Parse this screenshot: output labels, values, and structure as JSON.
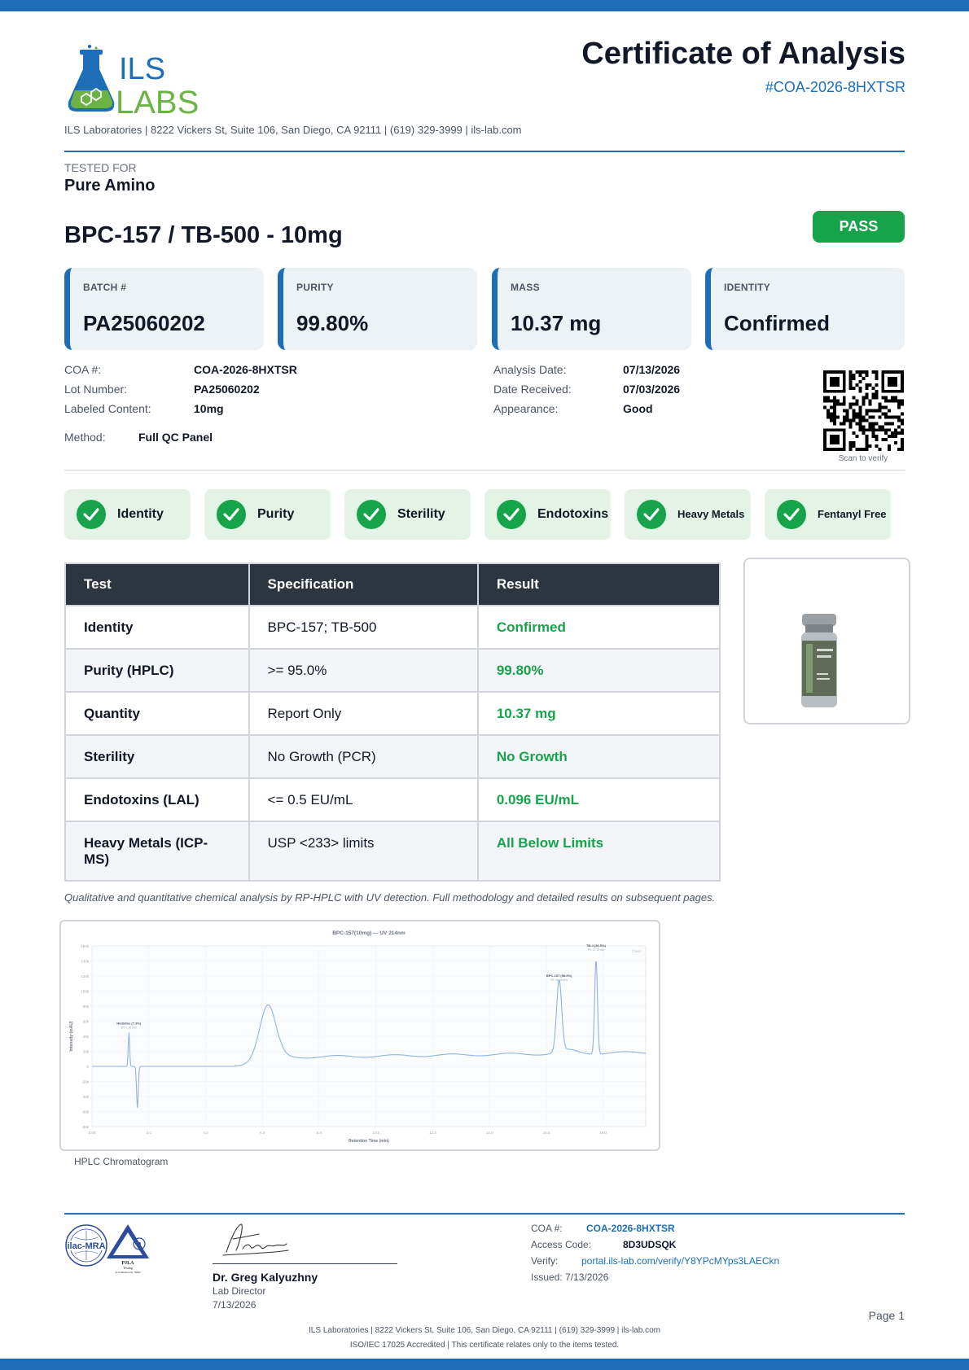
{
  "header": {
    "logo_text_top": "ILS",
    "logo_text_bottom": "LABS",
    "title": "Certificate of Analysis",
    "coa_id": "#COA-2026-8HXTSR",
    "lab_address": "ILS Laboratories  |  8222 Vickers St, Suite 106, San Diego, CA 92111  |  (619) 329-3999  |  ils-lab.com"
  },
  "tested_for": {
    "label": "TESTED FOR",
    "value": "Pure Amino"
  },
  "product": {
    "name": "BPC-157 / TB-500 - 10mg",
    "status": "PASS"
  },
  "summary_cards": [
    {
      "label": "BATCH #",
      "value": "PA25060202"
    },
    {
      "label": "PURITY",
      "value": "99.80%"
    },
    {
      "label": "MASS",
      "value": "10.37 mg"
    },
    {
      "label": "IDENTITY",
      "value": "Confirmed"
    }
  ],
  "meta_left": [
    {
      "label": "COA #:",
      "value": "COA-2026-8HXTSR"
    },
    {
      "label": "Lot Number:",
      "value": "PA25060202"
    },
    {
      "label": "Labeled Content:",
      "value": "10mg"
    }
  ],
  "method": {
    "label": "Method:",
    "value": "Full QC Panel"
  },
  "meta_right": [
    {
      "label": "Analysis Date:",
      "value": "07/13/2026"
    },
    {
      "label": "Date Received:",
      "value": "07/03/2026"
    },
    {
      "label": "Appearance:",
      "value": "Good"
    }
  ],
  "qr_caption": "Scan to verify",
  "badges": [
    "Identity",
    "Purity",
    "Sterility",
    "Endotoxins",
    "Heavy Metals",
    "Fentanyl Free"
  ],
  "results_table": {
    "headers": [
      "Test",
      "Specification",
      "Result"
    ],
    "rows": [
      {
        "test": "Identity",
        "spec": "BPC-157; TB-500",
        "result": "Confirmed"
      },
      {
        "test": "Purity (HPLC)",
        "spec": ">= 95.0%",
        "result": "99.80%"
      },
      {
        "test": "Quantity",
        "spec": "Report Only",
        "result": "10.37 mg"
      },
      {
        "test": "Sterility",
        "spec": "No Growth (PCR)",
        "result": "No Growth"
      },
      {
        "test": "Endotoxins (LAL)",
        "spec": "<= 0.5 EU/mL",
        "result": "0.096 EU/mL"
      },
      {
        "test": "Heavy Metals (ICP-MS)",
        "spec": "USP <233> limits",
        "result": "All Below Limits"
      }
    ]
  },
  "method_note": "Qualitative and quantitative chemical analysis by RP-HPLC with UV detection. Full methodology and detailed results on subsequent pages.",
  "chromatogram": {
    "title": "BPC-157(10mg) — UV 214nm",
    "xlabel": "Retention Time (min)",
    "ylabel": "Intensity (mAU)",
    "x_ticks": [
      "0.00",
      "2.0",
      "4.0",
      "6.0",
      "8.0",
      "10.0",
      "12.0",
      "14.0",
      "16.0",
      "18.0"
    ],
    "y_ticks": [
      "160k",
      "140k",
      "120k",
      "100k",
      "80k",
      "60k",
      "40k",
      "20k",
      "0",
      "-20k",
      "-40k",
      "-60k",
      "-80k"
    ],
    "legend": "Class",
    "peaks": [
      {
        "label": "Histidine (7.3%)",
        "rt_label": "RT: 1.30 min",
        "rt": 1.3,
        "height": 45
      },
      {
        "label": "BPC-157 (58.9%)",
        "rt_label": "RT: 16.45 min",
        "rt": 16.45,
        "height": 108
      },
      {
        "label": "TB-4 (36.5%)",
        "rt_label": "RT: 17.75 min",
        "rt": 17.75,
        "height": 148
      }
    ],
    "caption": "HPLC Chromatogram"
  },
  "signature": {
    "name": "Dr. Greg Kalyuzhny",
    "role": "Lab Director",
    "date": "7/13/2026"
  },
  "accreditation_logos": {
    "ilac": "ilac-MRA",
    "pjla": "PJLA",
    "pjla_sub": "Testing",
    "pjla_no": "Accreditation No. 59602"
  },
  "verify": {
    "coa_label": "COA #:",
    "coa_value": "COA-2026-8HXTSR",
    "access_label": "Access Code:",
    "access_value": "8D3UDSQK",
    "verify_label": "Verify:",
    "verify_value": "portal.ils-lab.com/verify/Y8YPcMYps3LAECkn",
    "issued": "Issued: 7/13/2026"
  },
  "page_label": "Page 1",
  "footer": {
    "line1": "ILS Laboratories  |  8222 Vickers St, Suite 106, San Diego, CA 92111  |  (619) 329-3999  |  ils-lab.com",
    "line2": "ISO/IEC 17025 Accredited  |  This certificate relates only to the items tested."
  },
  "colors": {
    "brand_blue": "#1e6db7",
    "pass_green": "#16a34a",
    "logo_green": "#6bb344",
    "header_dark": "#2d3540"
  }
}
